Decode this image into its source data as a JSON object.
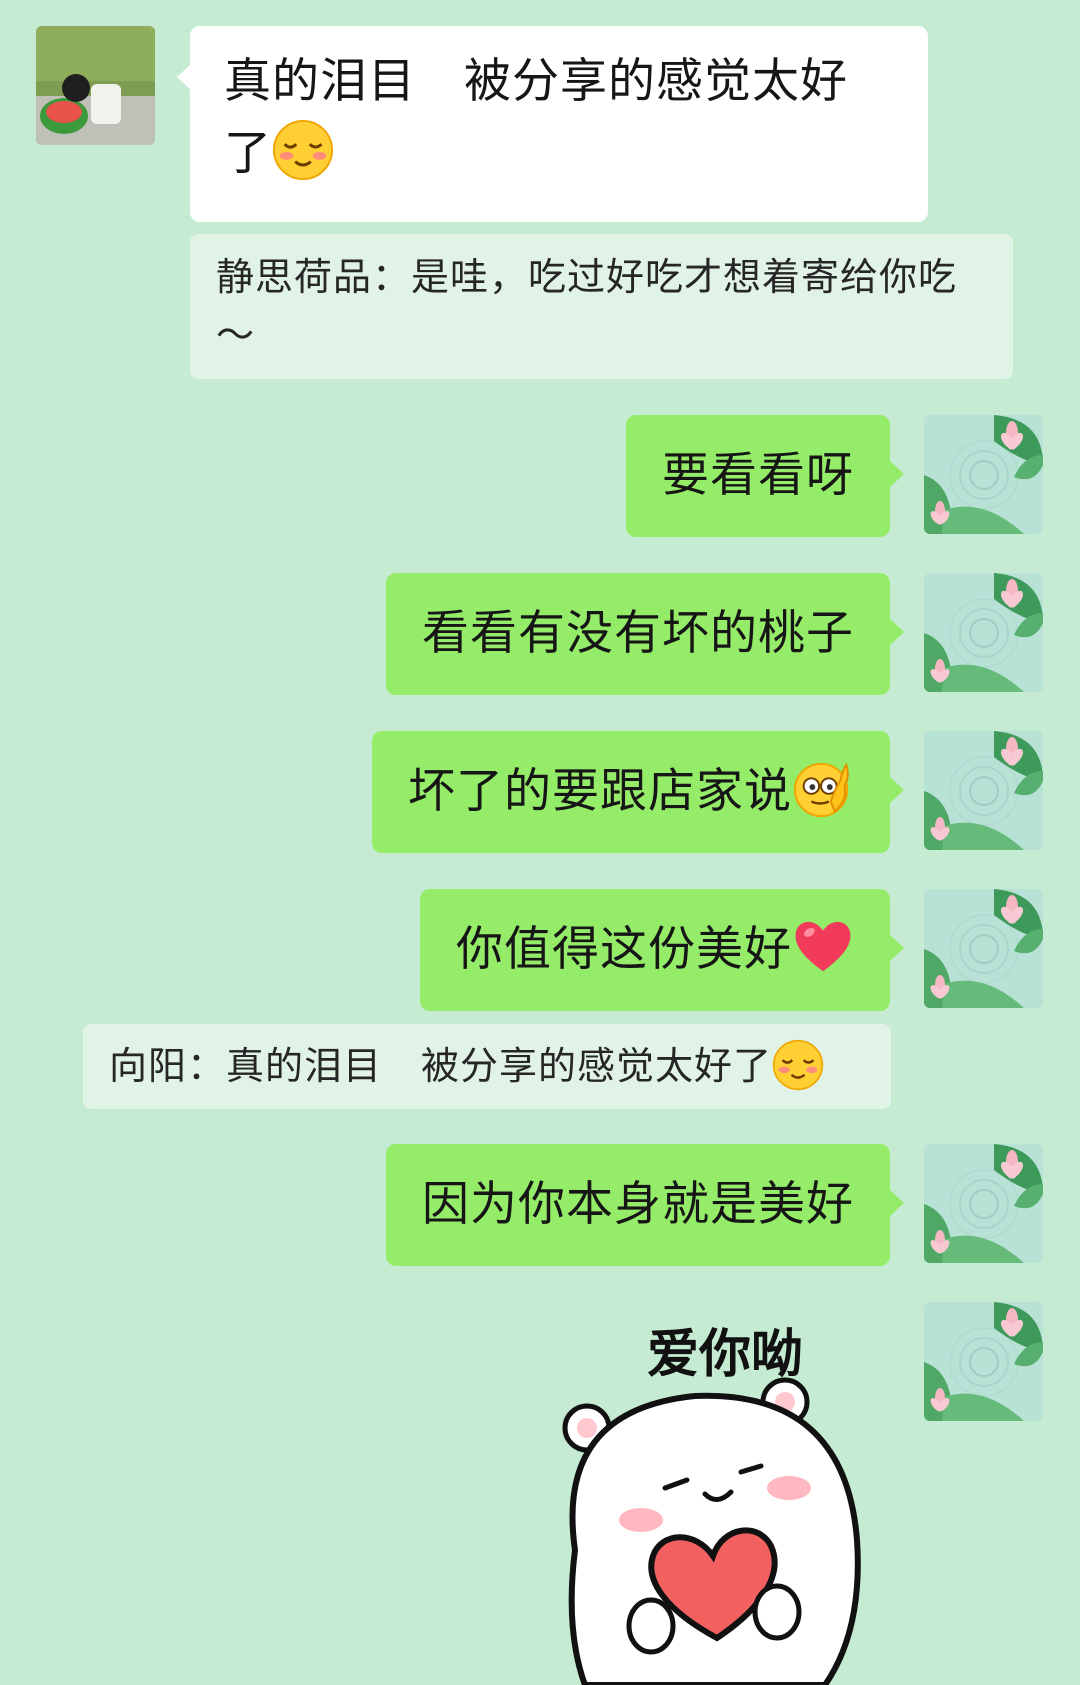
{
  "colors": {
    "background": "#c5ebd2",
    "incoming_bubble": "#ffffff",
    "outgoing_bubble": "#95ec69",
    "quote_background": "#e1f3e6"
  },
  "messages": [
    {
      "side": "left",
      "type": "text",
      "avatar": "user-avatar-field-photo",
      "text": "真的泪目　被分享的感觉太好了",
      "emoji": "blush-emoji"
    },
    {
      "type": "quote",
      "text": "静思荷品：是哇，吃过好吃才想着寄给你吃～"
    },
    {
      "side": "right",
      "type": "text",
      "avatar": "lotus-pond-avatar",
      "text": "要看看呀"
    },
    {
      "side": "right",
      "type": "text",
      "avatar": "lotus-pond-avatar",
      "text": "看看有没有坏的桃子"
    },
    {
      "side": "right",
      "type": "text",
      "avatar": "lotus-pond-avatar",
      "text": "坏了的要跟店家说",
      "emoji": "thinking-hand-emoji"
    },
    {
      "side": "right",
      "type": "text",
      "avatar": "lotus-pond-avatar",
      "text": "你值得这份美好",
      "emoji": "red-heart-emoji"
    },
    {
      "type": "quote",
      "text": "向阳：真的泪目　被分享的感觉太好了",
      "emoji": "blush-emoji"
    },
    {
      "side": "right",
      "type": "text",
      "avatar": "lotus-pond-avatar",
      "text": "因为你本身就是美好"
    },
    {
      "side": "right",
      "type": "sticker",
      "avatar": "lotus-pond-avatar",
      "sticker_text": "爱你呦",
      "sticker": "bear-holding-heart-sticker"
    }
  ]
}
